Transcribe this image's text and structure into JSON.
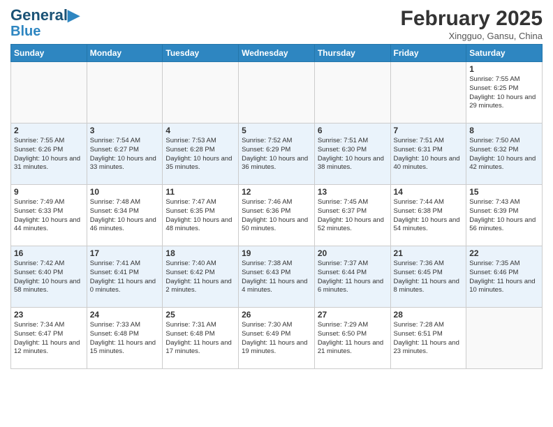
{
  "header": {
    "logo_line1": "General",
    "logo_line2": "Blue",
    "month": "February 2025",
    "location": "Xingguo, Gansu, China"
  },
  "days_of_week": [
    "Sunday",
    "Monday",
    "Tuesday",
    "Wednesday",
    "Thursday",
    "Friday",
    "Saturday"
  ],
  "weeks": [
    [
      {
        "day": "",
        "info": ""
      },
      {
        "day": "",
        "info": ""
      },
      {
        "day": "",
        "info": ""
      },
      {
        "day": "",
        "info": ""
      },
      {
        "day": "",
        "info": ""
      },
      {
        "day": "",
        "info": ""
      },
      {
        "day": "1",
        "info": "Sunrise: 7:55 AM\nSunset: 6:25 PM\nDaylight: 10 hours and 29 minutes."
      }
    ],
    [
      {
        "day": "2",
        "info": "Sunrise: 7:55 AM\nSunset: 6:26 PM\nDaylight: 10 hours and 31 minutes."
      },
      {
        "day": "3",
        "info": "Sunrise: 7:54 AM\nSunset: 6:27 PM\nDaylight: 10 hours and 33 minutes."
      },
      {
        "day": "4",
        "info": "Sunrise: 7:53 AM\nSunset: 6:28 PM\nDaylight: 10 hours and 35 minutes."
      },
      {
        "day": "5",
        "info": "Sunrise: 7:52 AM\nSunset: 6:29 PM\nDaylight: 10 hours and 36 minutes."
      },
      {
        "day": "6",
        "info": "Sunrise: 7:51 AM\nSunset: 6:30 PM\nDaylight: 10 hours and 38 minutes."
      },
      {
        "day": "7",
        "info": "Sunrise: 7:51 AM\nSunset: 6:31 PM\nDaylight: 10 hours and 40 minutes."
      },
      {
        "day": "8",
        "info": "Sunrise: 7:50 AM\nSunset: 6:32 PM\nDaylight: 10 hours and 42 minutes."
      }
    ],
    [
      {
        "day": "9",
        "info": "Sunrise: 7:49 AM\nSunset: 6:33 PM\nDaylight: 10 hours and 44 minutes."
      },
      {
        "day": "10",
        "info": "Sunrise: 7:48 AM\nSunset: 6:34 PM\nDaylight: 10 hours and 46 minutes."
      },
      {
        "day": "11",
        "info": "Sunrise: 7:47 AM\nSunset: 6:35 PM\nDaylight: 10 hours and 48 minutes."
      },
      {
        "day": "12",
        "info": "Sunrise: 7:46 AM\nSunset: 6:36 PM\nDaylight: 10 hours and 50 minutes."
      },
      {
        "day": "13",
        "info": "Sunrise: 7:45 AM\nSunset: 6:37 PM\nDaylight: 10 hours and 52 minutes."
      },
      {
        "day": "14",
        "info": "Sunrise: 7:44 AM\nSunset: 6:38 PM\nDaylight: 10 hours and 54 minutes."
      },
      {
        "day": "15",
        "info": "Sunrise: 7:43 AM\nSunset: 6:39 PM\nDaylight: 10 hours and 56 minutes."
      }
    ],
    [
      {
        "day": "16",
        "info": "Sunrise: 7:42 AM\nSunset: 6:40 PM\nDaylight: 10 hours and 58 minutes."
      },
      {
        "day": "17",
        "info": "Sunrise: 7:41 AM\nSunset: 6:41 PM\nDaylight: 11 hours and 0 minutes."
      },
      {
        "day": "18",
        "info": "Sunrise: 7:40 AM\nSunset: 6:42 PM\nDaylight: 11 hours and 2 minutes."
      },
      {
        "day": "19",
        "info": "Sunrise: 7:38 AM\nSunset: 6:43 PM\nDaylight: 11 hours and 4 minutes."
      },
      {
        "day": "20",
        "info": "Sunrise: 7:37 AM\nSunset: 6:44 PM\nDaylight: 11 hours and 6 minutes."
      },
      {
        "day": "21",
        "info": "Sunrise: 7:36 AM\nSunset: 6:45 PM\nDaylight: 11 hours and 8 minutes."
      },
      {
        "day": "22",
        "info": "Sunrise: 7:35 AM\nSunset: 6:46 PM\nDaylight: 11 hours and 10 minutes."
      }
    ],
    [
      {
        "day": "23",
        "info": "Sunrise: 7:34 AM\nSunset: 6:47 PM\nDaylight: 11 hours and 12 minutes."
      },
      {
        "day": "24",
        "info": "Sunrise: 7:33 AM\nSunset: 6:48 PM\nDaylight: 11 hours and 15 minutes."
      },
      {
        "day": "25",
        "info": "Sunrise: 7:31 AM\nSunset: 6:48 PM\nDaylight: 11 hours and 17 minutes."
      },
      {
        "day": "26",
        "info": "Sunrise: 7:30 AM\nSunset: 6:49 PM\nDaylight: 11 hours and 19 minutes."
      },
      {
        "day": "27",
        "info": "Sunrise: 7:29 AM\nSunset: 6:50 PM\nDaylight: 11 hours and 21 minutes."
      },
      {
        "day": "28",
        "info": "Sunrise: 7:28 AM\nSunset: 6:51 PM\nDaylight: 11 hours and 23 minutes."
      },
      {
        "day": "",
        "info": ""
      }
    ]
  ]
}
